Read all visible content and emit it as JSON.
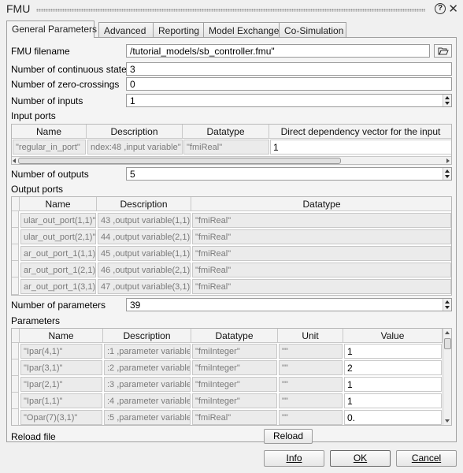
{
  "window": {
    "title": "FMU"
  },
  "tabs": [
    {
      "label": "General Parameters",
      "active": true
    },
    {
      "label": "Advanced",
      "active": false
    },
    {
      "label": "Reporting",
      "active": false
    },
    {
      "label": "Model Exchange",
      "active": false
    },
    {
      "label": "Co-Simulation",
      "active": false
    }
  ],
  "form": {
    "fmu_filename_label": "FMU filename",
    "fmu_filename_value": "/tutorial_models/sb_controller.fmu\"",
    "continuous_states_label": "Number of continuous states",
    "continuous_states_value": "3",
    "zero_crossings_label": "Number of zero-crossings",
    "zero_crossings_value": "0",
    "inputs_label": "Number of inputs",
    "inputs_value": "1",
    "input_ports_label": "Input ports",
    "outputs_label": "Number of outputs",
    "outputs_value": "5",
    "output_ports_label": "Output ports",
    "parameters_count_label": "Number of parameters",
    "parameters_count_value": "39",
    "parameters_label": "Parameters",
    "reload_label": "Reload file"
  },
  "input_table": {
    "headers": [
      "Name",
      "Description",
      "Datatype",
      "Direct dependency vector for the input"
    ],
    "rows": [
      [
        "\"regular_in_port\"",
        "ndex:48 ,input variable\"",
        "\"fmiReal\"",
        "1"
      ]
    ]
  },
  "output_table": {
    "headers": [
      "Name",
      "Description",
      "Datatype"
    ],
    "rows": [
      [
        "ular_out_port(1,1)\"",
        "43 ,output variable(1,1)\"",
        "\"fmiReal\""
      ],
      [
        "ular_out_port(2,1)\"",
        "44 ,output variable(2,1)\"",
        "\"fmiReal\""
      ],
      [
        "ar_out_port_1(1,1)\"",
        "45 ,output variable(1,1)\"",
        "\"fmiReal\""
      ],
      [
        "ar_out_port_1(2,1)\"",
        "46 ,output variable(2,1)\"",
        "\"fmiReal\""
      ],
      [
        "ar_out_port_1(3,1)\"",
        "47 ,output variable(3,1)\"",
        "\"fmiReal\""
      ]
    ]
  },
  "param_table": {
    "headers": [
      "Name",
      "Description",
      "Datatype",
      "Unit",
      "Value"
    ],
    "rows": [
      [
        "\"Ipar(4,1)\"",
        ":1 ,parameter variable\"",
        "\"fmiInteger\"",
        "\"\"",
        "1"
      ],
      [
        "\"Ipar(3,1)\"",
        ":2 ,parameter variable\"",
        "\"fmiInteger\"",
        "\"\"",
        "2"
      ],
      [
        "\"Ipar(2,1)\"",
        ":3 ,parameter variable\"",
        "\"fmiInteger\"",
        "\"\"",
        "1"
      ],
      [
        "\"Ipar(1,1)\"",
        ":4 ,parameter variable\"",
        "\"fmiInteger\"",
        "\"\"",
        "1"
      ],
      [
        "\"Opar(7)(3,1)\"",
        ":5 ,parameter variable\"",
        "\"fmiReal\"",
        "\"\"",
        "0."
      ]
    ]
  },
  "buttons": {
    "reload": "Reload",
    "info": "Info",
    "ok": "OK",
    "cancel": "Cancel"
  },
  "icons": {
    "help": "help-icon",
    "close": "close-icon",
    "folder": "folder-open-icon"
  }
}
